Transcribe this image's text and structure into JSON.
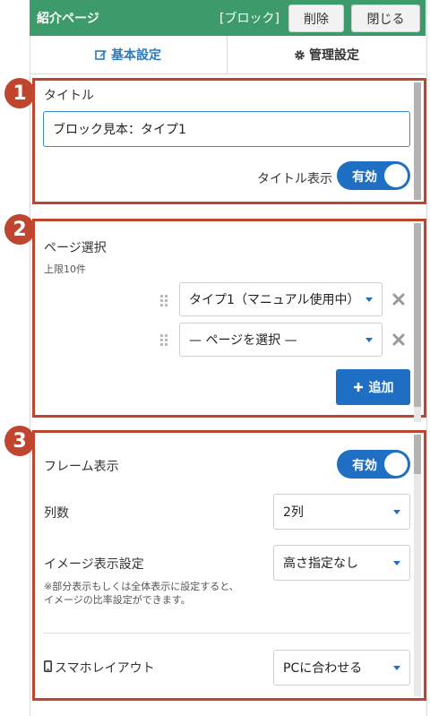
{
  "header": {
    "title": "紹介ページ",
    "block_label": "[ブロック]",
    "delete_label": "削除",
    "close_label": "閉じる"
  },
  "tabs": [
    {
      "label": "基本設定",
      "icon": "edit-icon",
      "active": true
    },
    {
      "label": "管理設定",
      "icon": "gear-icon",
      "active": false
    }
  ],
  "badges": [
    "1",
    "2",
    "3"
  ],
  "section1": {
    "title_label": "タイトル",
    "title_value": "ブロック見本：タイプ1",
    "show_title_label": "タイトル表示",
    "toggle_label": "有効"
  },
  "section2": {
    "page_select_label": "ページ選択",
    "limit_label": "上限10件",
    "rows": [
      {
        "value": "タイプ1（マニュアル使用中）"
      },
      {
        "value": "— ページを選択 —"
      }
    ],
    "add_label": "追加"
  },
  "section3": {
    "frame_label": "フレーム表示",
    "frame_toggle_label": "有効",
    "columns_label": "列数",
    "columns_value": "2列",
    "image_setting_label": "イメージ表示設定",
    "image_setting_value": "高さ指定なし",
    "image_note_line1": "※部分表示もしくは全体表示に設定すると、",
    "image_note_line2": "イメージの比率設定ができます。",
    "sp_layout_label": "スマホレイアウト",
    "sp_layout_value": "PCに合わせる"
  },
  "colors": {
    "header_bg": "#3d9a6a",
    "accent": "#1f6fc4",
    "annotation_red": "#c0452f"
  }
}
